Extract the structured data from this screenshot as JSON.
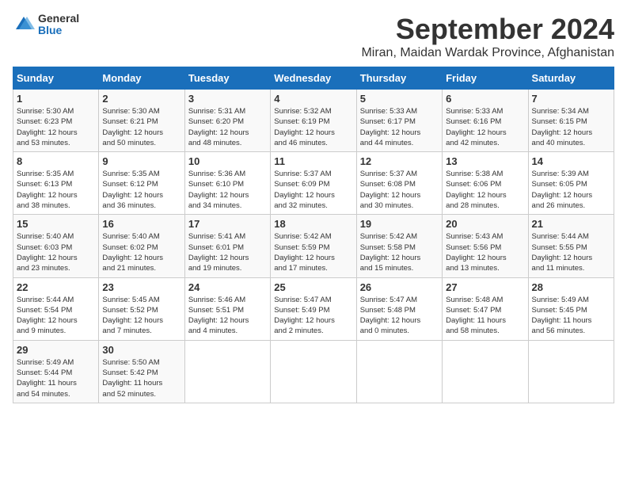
{
  "logo": {
    "general": "General",
    "blue": "Blue"
  },
  "title": "September 2024",
  "location": "Miran, Maidan Wardak Province, Afghanistan",
  "headers": [
    "Sunday",
    "Monday",
    "Tuesday",
    "Wednesday",
    "Thursday",
    "Friday",
    "Saturday"
  ],
  "weeks": [
    [
      {
        "day": "1",
        "sunrise": "5:30 AM",
        "sunset": "6:23 PM",
        "daylight": "12 hours and 53 minutes."
      },
      {
        "day": "2",
        "sunrise": "5:30 AM",
        "sunset": "6:21 PM",
        "daylight": "12 hours and 50 minutes."
      },
      {
        "day": "3",
        "sunrise": "5:31 AM",
        "sunset": "6:20 PM",
        "daylight": "12 hours and 48 minutes."
      },
      {
        "day": "4",
        "sunrise": "5:32 AM",
        "sunset": "6:19 PM",
        "daylight": "12 hours and 46 minutes."
      },
      {
        "day": "5",
        "sunrise": "5:33 AM",
        "sunset": "6:17 PM",
        "daylight": "12 hours and 44 minutes."
      },
      {
        "day": "6",
        "sunrise": "5:33 AM",
        "sunset": "6:16 PM",
        "daylight": "12 hours and 42 minutes."
      },
      {
        "day": "7",
        "sunrise": "5:34 AM",
        "sunset": "6:15 PM",
        "daylight": "12 hours and 40 minutes."
      }
    ],
    [
      {
        "day": "8",
        "sunrise": "5:35 AM",
        "sunset": "6:13 PM",
        "daylight": "12 hours and 38 minutes."
      },
      {
        "day": "9",
        "sunrise": "5:35 AM",
        "sunset": "6:12 PM",
        "daylight": "12 hours and 36 minutes."
      },
      {
        "day": "10",
        "sunrise": "5:36 AM",
        "sunset": "6:10 PM",
        "daylight": "12 hours and 34 minutes."
      },
      {
        "day": "11",
        "sunrise": "5:37 AM",
        "sunset": "6:09 PM",
        "daylight": "12 hours and 32 minutes."
      },
      {
        "day": "12",
        "sunrise": "5:37 AM",
        "sunset": "6:08 PM",
        "daylight": "12 hours and 30 minutes."
      },
      {
        "day": "13",
        "sunrise": "5:38 AM",
        "sunset": "6:06 PM",
        "daylight": "12 hours and 28 minutes."
      },
      {
        "day": "14",
        "sunrise": "5:39 AM",
        "sunset": "6:05 PM",
        "daylight": "12 hours and 26 minutes."
      }
    ],
    [
      {
        "day": "15",
        "sunrise": "5:40 AM",
        "sunset": "6:03 PM",
        "daylight": "12 hours and 23 minutes."
      },
      {
        "day": "16",
        "sunrise": "5:40 AM",
        "sunset": "6:02 PM",
        "daylight": "12 hours and 21 minutes."
      },
      {
        "day": "17",
        "sunrise": "5:41 AM",
        "sunset": "6:01 PM",
        "daylight": "12 hours and 19 minutes."
      },
      {
        "day": "18",
        "sunrise": "5:42 AM",
        "sunset": "5:59 PM",
        "daylight": "12 hours and 17 minutes."
      },
      {
        "day": "19",
        "sunrise": "5:42 AM",
        "sunset": "5:58 PM",
        "daylight": "12 hours and 15 minutes."
      },
      {
        "day": "20",
        "sunrise": "5:43 AM",
        "sunset": "5:56 PM",
        "daylight": "12 hours and 13 minutes."
      },
      {
        "day": "21",
        "sunrise": "5:44 AM",
        "sunset": "5:55 PM",
        "daylight": "12 hours and 11 minutes."
      }
    ],
    [
      {
        "day": "22",
        "sunrise": "5:44 AM",
        "sunset": "5:54 PM",
        "daylight": "12 hours and 9 minutes."
      },
      {
        "day": "23",
        "sunrise": "5:45 AM",
        "sunset": "5:52 PM",
        "daylight": "12 hours and 7 minutes."
      },
      {
        "day": "24",
        "sunrise": "5:46 AM",
        "sunset": "5:51 PM",
        "daylight": "12 hours and 4 minutes."
      },
      {
        "day": "25",
        "sunrise": "5:47 AM",
        "sunset": "5:49 PM",
        "daylight": "12 hours and 2 minutes."
      },
      {
        "day": "26",
        "sunrise": "5:47 AM",
        "sunset": "5:48 PM",
        "daylight": "12 hours and 0 minutes."
      },
      {
        "day": "27",
        "sunrise": "5:48 AM",
        "sunset": "5:47 PM",
        "daylight": "11 hours and 58 minutes."
      },
      {
        "day": "28",
        "sunrise": "5:49 AM",
        "sunset": "5:45 PM",
        "daylight": "11 hours and 56 minutes."
      }
    ],
    [
      {
        "day": "29",
        "sunrise": "5:49 AM",
        "sunset": "5:44 PM",
        "daylight": "11 hours and 54 minutes."
      },
      {
        "day": "30",
        "sunrise": "5:50 AM",
        "sunset": "5:42 PM",
        "daylight": "11 hours and 52 minutes."
      },
      null,
      null,
      null,
      null,
      null
    ]
  ],
  "labels": {
    "sunrise": "Sunrise:",
    "sunset": "Sunset:",
    "daylight": "Daylight:"
  }
}
